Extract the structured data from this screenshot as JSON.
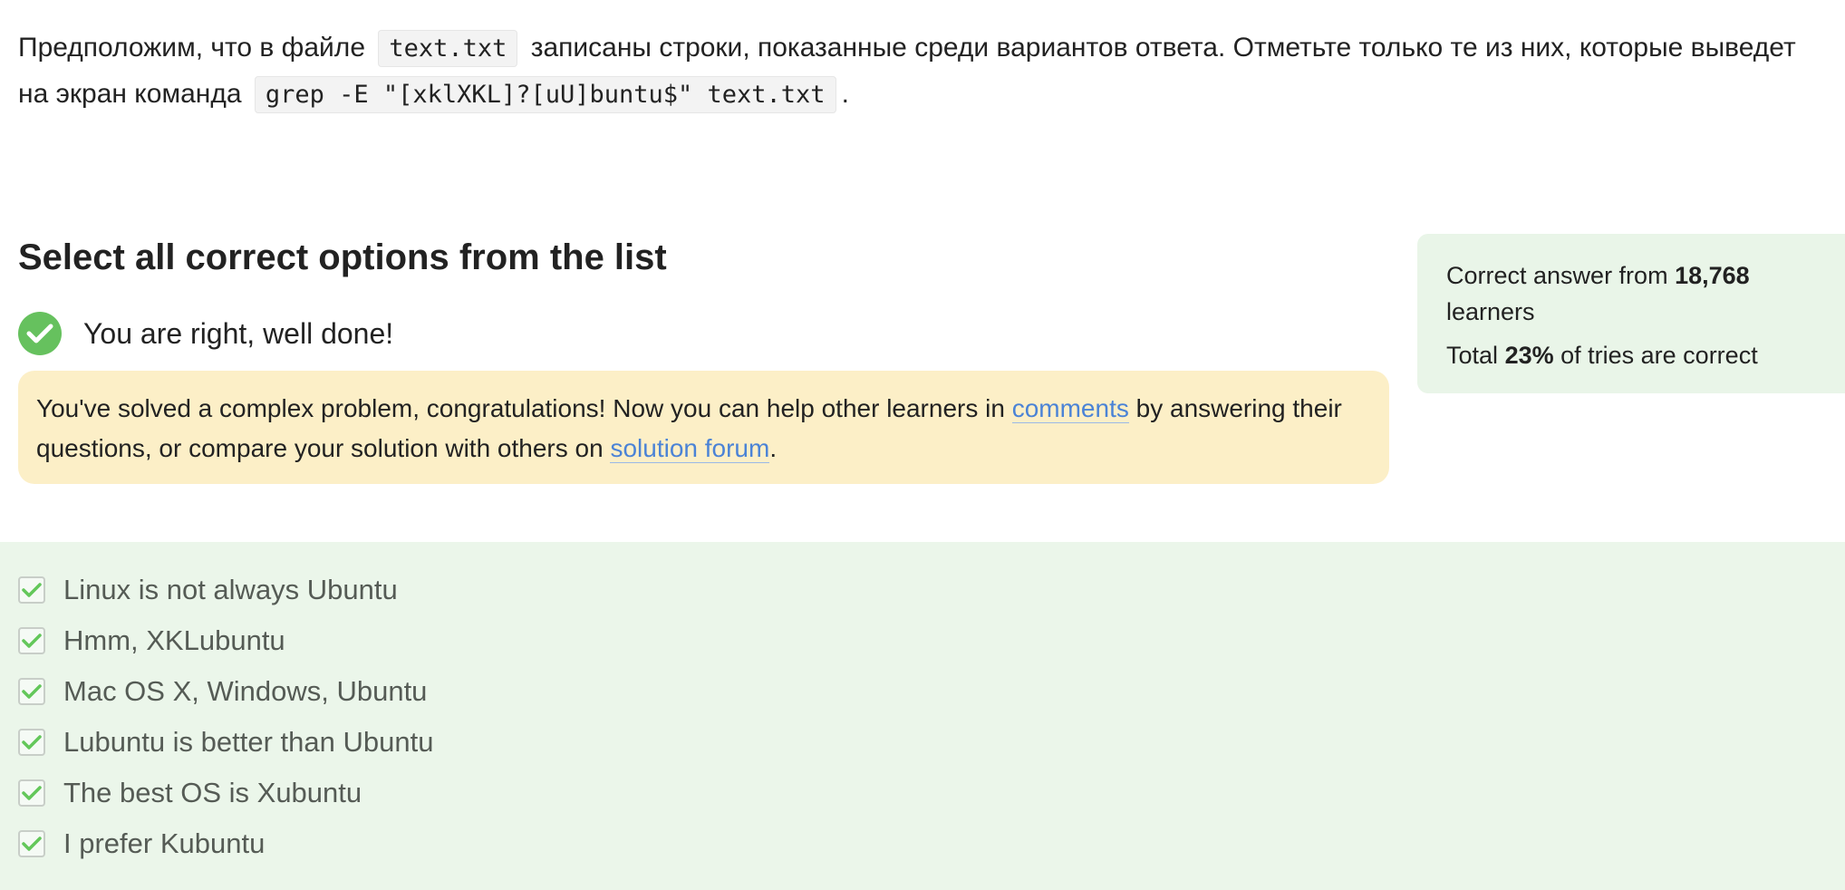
{
  "question": {
    "text_before": "Предположим, что в файле",
    "code_file": "text.txt",
    "text_middle": "записаны строки, показанные среди вариантов ответа. Отметьте только те из них, которые выведет на экран команда",
    "code_command": "grep -E \"[xklXKL]?[uU]buntu$\" text.txt",
    "text_end": "."
  },
  "heading": "Select all correct options from the list",
  "result": {
    "icon": "check-circle-icon",
    "text": "You are right, well done!",
    "color": "#66c15e"
  },
  "congrats": {
    "text_1": "You've solved a complex problem, congratulations! Now you can help other learners in",
    "link_comments": "comments",
    "text_2": "by answering their questions, or compare your solution with others on",
    "link_forum": "solution forum",
    "text_3": "."
  },
  "stats": {
    "line1_prefix": "Correct answer from",
    "learners_count": "18,768",
    "line1_suffix": "learners",
    "line2_prefix": "Total",
    "percent": "23%",
    "line2_suffix": "of tries are correct"
  },
  "options": [
    {
      "label": "Linux is not always Ubuntu",
      "checked": true
    },
    {
      "label": "Hmm, XKLubuntu",
      "checked": true
    },
    {
      "label": "Mac OS X, Windows, Ubuntu",
      "checked": true
    },
    {
      "label": "Lubuntu is better than Ubuntu",
      "checked": true
    },
    {
      "label": "The best OS is Xubuntu",
      "checked": true
    },
    {
      "label": "I prefer Kubuntu",
      "checked": true
    }
  ]
}
